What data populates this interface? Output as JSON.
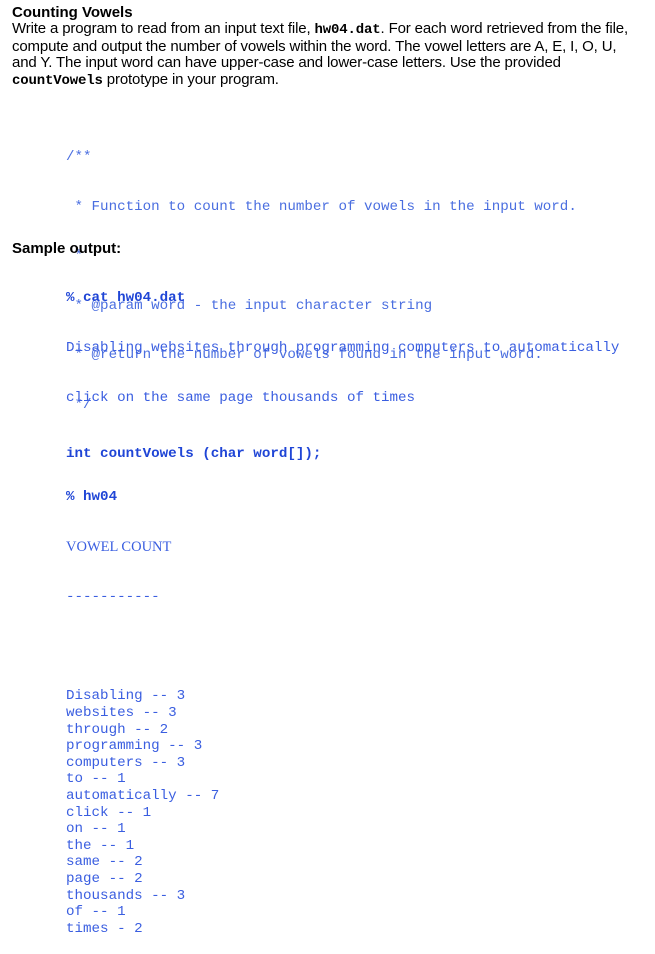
{
  "title": "Counting Vowels",
  "paragraph": {
    "lines": [
      [
        "Write a program to read from an input text file, ",
        "hw04.dat",
        ".  For each word retrieved from the file,"
      ],
      [
        "compute and output the number of vowels within the word.  The vowel letters are A, E, I, O, U,"
      ],
      [
        "and Y.  The input word can have upper-case and lower-case letters.  Use the provided"
      ],
      [
        "",
        "countVowels",
        " prototype in your program."
      ]
    ],
    "line1_pre": "Write a program to read from an input text file, ",
    "line1_code": "hw04.dat",
    "line1_post": ".  For each word retrieved from the file,",
    "line2": "compute and output the number of vowels within the word.  The vowel letters are A, E, I, O, U,",
    "line3": "and Y.  The input word can have upper-case and lower-case letters.  Use the provided",
    "line4_code": "countVowels",
    "line4_post": " prototype in your program."
  },
  "code": {
    "comment_lines": [
      "/**",
      " * Function to count the number of vowels in the input word.",
      " *",
      " * @param word - the input character string",
      " * @return the number of vowels found in the input word.",
      " */"
    ],
    "declaration": "int countVowels (char word[]);"
  },
  "sample": {
    "label": "Sample output:",
    "cmd1": "% cat hw04.dat",
    "file_lines": [
      "Disabling websites through programming computers to automatically",
      "click on the same page thousands of times"
    ],
    "cmd2": "% hw04",
    "header": "VOWEL COUNT",
    "separator": "-----------",
    "results": [
      {
        "word": "Disabling",
        "sep": "--",
        "count": 3
      },
      {
        "word": "websites",
        "sep": "--",
        "count": 3
      },
      {
        "word": "through",
        "sep": "--",
        "count": 2
      },
      {
        "word": "programming",
        "sep": "--",
        "count": 3
      },
      {
        "word": "computers",
        "sep": "--",
        "count": 3
      },
      {
        "word": "to",
        "sep": "--",
        "count": 1
      },
      {
        "word": "automatically",
        "sep": "--",
        "count": 7
      },
      {
        "word": "click",
        "sep": "--",
        "count": 1
      },
      {
        "word": "on",
        "sep": "--",
        "count": 1
      },
      {
        "word": "the",
        "sep": "--",
        "count": 1
      },
      {
        "word": "same",
        "sep": "--",
        "count": 2
      },
      {
        "word": "page",
        "sep": "--",
        "count": 2
      },
      {
        "word": "thousands",
        "sep": "--",
        "count": 3
      },
      {
        "word": "of",
        "sep": "--",
        "count": 1
      },
      {
        "word": "times",
        "sep": "-",
        "count": 2
      }
    ]
  },
  "colors": {
    "comment": "#4a6ee0",
    "code_bold": "#1f45d6",
    "output": "#3a5ee0",
    "text": "#000000"
  }
}
